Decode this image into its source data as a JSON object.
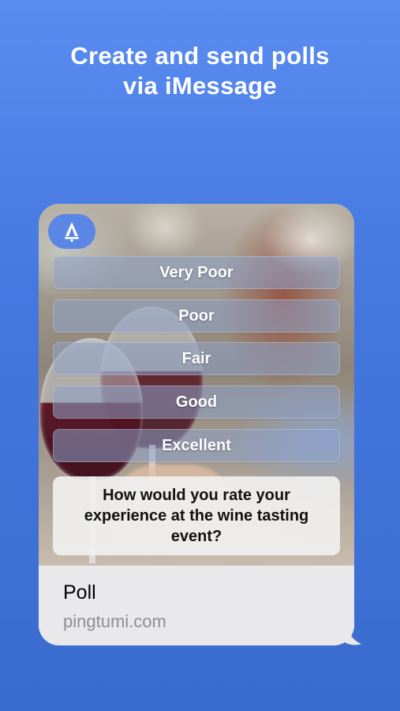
{
  "headline": {
    "line1": "Create and send polls",
    "line2": "via iMessage"
  },
  "poll": {
    "app_icon": "tent-bell-icon",
    "options": [
      "Very Poor",
      "Poor",
      "Fair",
      "Good",
      "Excellent"
    ],
    "question": "How would you rate your experience at the wine tasting event?"
  },
  "footer": {
    "title": "Poll",
    "url": "pingtumi.com"
  },
  "colors": {
    "background_top": "#5a8cf0",
    "background_bottom": "#3a6ccf",
    "logo_bg": "#5a86e6",
    "footer_bg": "#e9e9eb",
    "url_text": "#8e8e93"
  }
}
